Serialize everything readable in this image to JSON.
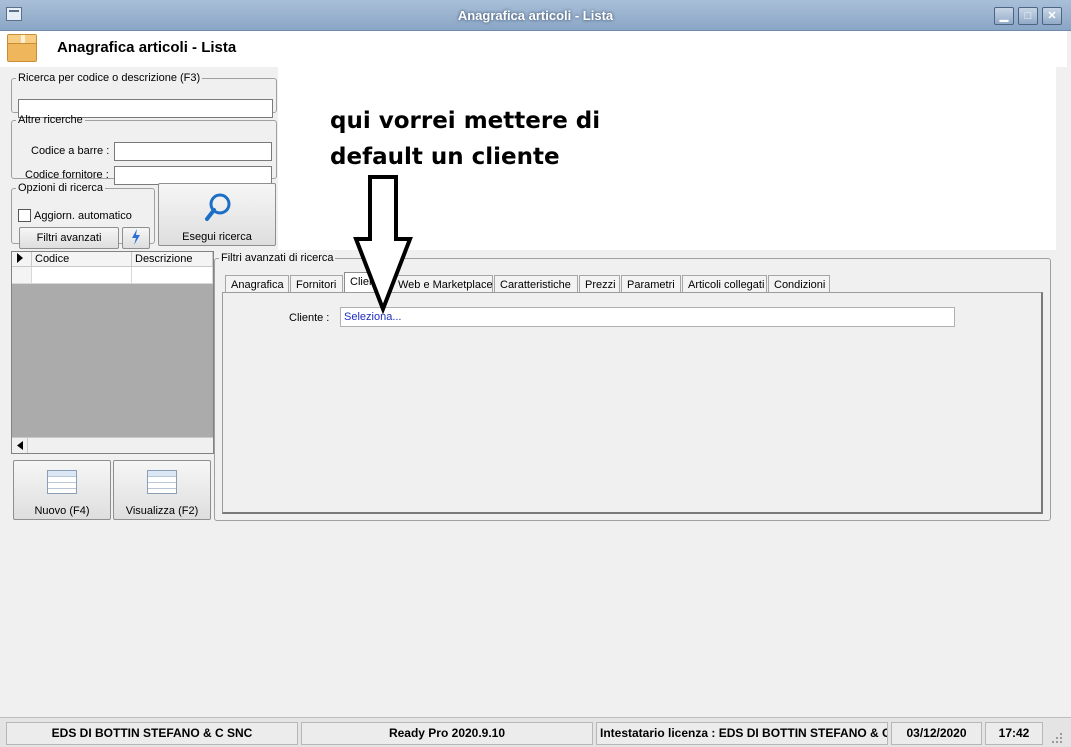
{
  "window": {
    "title": "Anagrafica articoli  - Lista",
    "minimize_glyph": "▁",
    "maximize_glyph": "□",
    "close_glyph": "✕"
  },
  "header": {
    "title": "Anagrafica articoli  - Lista"
  },
  "search": {
    "group_label": "Ricerca per codice o descrizione (F3)",
    "value": ""
  },
  "other_search": {
    "group_label": "Altre ricerche",
    "barcode_label": "Codice a barre :",
    "barcode_value": "",
    "supplier_code_label": "Codice fornitore :",
    "supplier_code_value": ""
  },
  "search_options": {
    "group_label": "Opzioni di ricerca",
    "auto_update_label": "Aggiorn. automatico",
    "auto_update_checked": false,
    "advanced_filters_label": "Filtri avanzati"
  },
  "run_search": {
    "label": "Esegui ricerca"
  },
  "grid": {
    "columns": [
      "Codice",
      "Descrizione"
    ]
  },
  "actions": {
    "new_label": "Nuovo (F4)",
    "view_label": "Visualizza (F2)"
  },
  "advanced_filters": {
    "group_label": "Filtri avanzati di ricerca",
    "tabs": [
      {
        "label": "Anagrafica"
      },
      {
        "label": "Fornitori"
      },
      {
        "label": "Clienti"
      },
      {
        "label": "Web e Marketplace"
      },
      {
        "label": "Caratteristiche"
      },
      {
        "label": "Prezzi"
      },
      {
        "label": "Parametri"
      },
      {
        "label": "Articoli collegati"
      },
      {
        "label": "Condizioni"
      }
    ],
    "active_tab": "Clienti",
    "client_label": "Cliente :",
    "client_value": "Seleziona..."
  },
  "annotation": {
    "text": "qui vorrei mettere di\ndefault un cliente"
  },
  "statusbar": {
    "company": "EDS DI BOTTIN STEFANO & C SNC",
    "version": "Ready Pro 2020.9.10",
    "license": "Intestatario licenza : EDS DI BOTTIN STEFANO & C SNC",
    "date": "03/12/2020",
    "time": "17:42"
  },
  "colors": {
    "titlebar": "#8aa6c6",
    "link_text": "#1f2dbf",
    "annotation_arrow": "#000000"
  }
}
